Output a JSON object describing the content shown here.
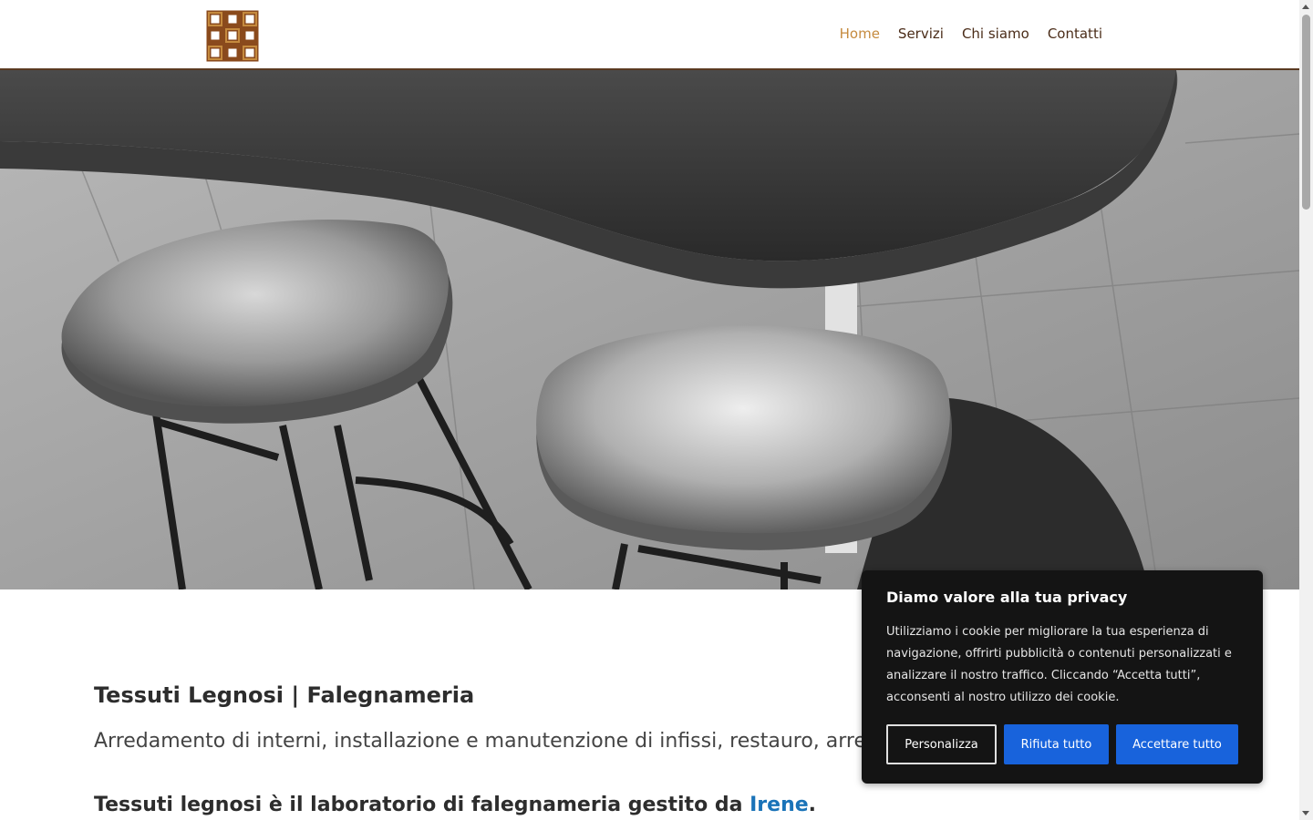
{
  "header": {
    "nav": [
      {
        "label": "Home",
        "active": true
      },
      {
        "label": "Servizi",
        "active": false
      },
      {
        "label": "Chi siamo",
        "active": false
      },
      {
        "label": "Contatti",
        "active": false
      }
    ]
  },
  "colors": {
    "nav_active": "#c58a3e",
    "nav_text": "#4a2c18",
    "link_blue": "#1a73b8",
    "cookie_bg": "#141414",
    "cookie_button_blue": "#1863dc"
  },
  "content": {
    "title": "Tessuti Legnosi | Falegnameria",
    "subtitle": "Arredamento di interni, installazione e manutenzione di infissi, restauro, arredo p",
    "intro_text": "Tessuti legnosi è il laboratorio di falegnameria gestito da",
    "intro_link": "Irene",
    "intro_end": "."
  },
  "cookie_banner": {
    "title": "Diamo valore alla tua privacy",
    "body": "Utilizziamo i cookie per migliorare la tua esperienza di navigazione, offrirti pubblicità o contenuti personalizzati e analizzare il nostro traffico. Cliccando “Accetta tutti”, acconsenti al nostro utilizzo dei cookie.",
    "customize_label": "Personalizza",
    "reject_label": "Rifiuta tutto",
    "accept_label": "Accettare tutto"
  },
  "icons": {
    "logo": "endless-knot-logo",
    "scroll_up": "arrow-up-icon",
    "scroll_down": "arrow-down-icon"
  }
}
